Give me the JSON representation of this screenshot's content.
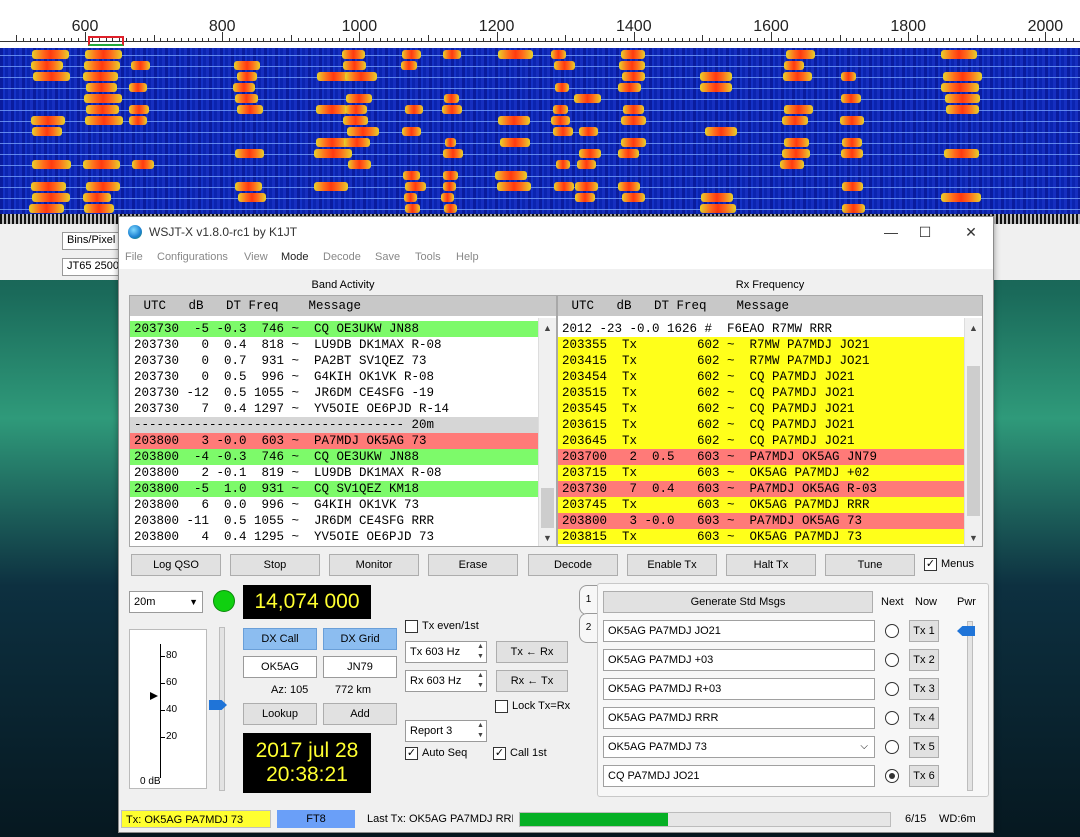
{
  "waterfall": {
    "freq_ticks": [
      "600",
      "800",
      "1000",
      "1200",
      "1400",
      "1600",
      "1800",
      "2000"
    ],
    "bins_per_pixel_label": "Bins/Pixel",
    "mode_field": "JT65  2500"
  },
  "window": {
    "title": "WSJT-X   v1.8.0-rc1   by K1JT",
    "minimize": "—",
    "maximize": "☐",
    "close": "✕"
  },
  "menu": [
    "File",
    "Configurations",
    "View",
    "Mode",
    "Decode",
    "Save",
    "Tools",
    "Help"
  ],
  "band_activity": {
    "title": "Band Activity",
    "header": " UTC   dB   DT Freq    Message",
    "rows": [
      {
        "text": "203730  -5 -0.3  746 ~  CQ OE3UKW JN88",
        "style": "green"
      },
      {
        "text": "203730   0  0.4  818 ~  LU9DB DK1MAX R-08",
        "style": ""
      },
      {
        "text": "203730   0  0.7  931 ~  PA2BT SV1QEZ 73",
        "style": ""
      },
      {
        "text": "203730   0  0.5  996 ~  G4KIH OK1VK R-08",
        "style": ""
      },
      {
        "text": "203730 -12  0.5 1055 ~  JR6DM CE4SFG -19",
        "style": ""
      },
      {
        "text": "203730   7  0.4 1297 ~  YV5OIE OE6PJD R-14",
        "style": ""
      },
      {
        "text": "------------------------------------ 20m",
        "style": "sep"
      },
      {
        "text": "203800   3 -0.0  603 ~  PA7MDJ OK5AG 73",
        "style": "red"
      },
      {
        "text": "203800  -4 -0.3  746 ~  CQ OE3UKW JN88",
        "style": "green"
      },
      {
        "text": "203800   2 -0.1  819 ~  LU9DB DK1MAX R-08",
        "style": ""
      },
      {
        "text": "203800  -5  1.0  931 ~  CQ SV1QEZ KM18",
        "style": "green"
      },
      {
        "text": "203800   6  0.0  996 ~  G4KIH OK1VK 73",
        "style": ""
      },
      {
        "text": "203800 -11  0.5 1055 ~  JR6DM CE4SFG RRR",
        "style": ""
      },
      {
        "text": "203800   4  0.4 1295 ~  YV5OIE OE6PJD 73",
        "style": ""
      }
    ]
  },
  "rx_frequency": {
    "title": "Rx Frequency",
    "header": " UTC   dB   DT Freq    Message",
    "rows": [
      {
        "text": "2012 -23 -0.0 1626 #  F6EAO R7MW RRR",
        "style": ""
      },
      {
        "text": "203355  Tx        602 ~  R7MW PA7MDJ JO21",
        "style": "yellow"
      },
      {
        "text": "203415  Tx        602 ~  R7MW PA7MDJ JO21",
        "style": "yellow"
      },
      {
        "text": "203454  Tx        602 ~  CQ PA7MDJ JO21",
        "style": "yellow"
      },
      {
        "text": "203515  Tx        602 ~  CQ PA7MDJ JO21",
        "style": "yellow"
      },
      {
        "text": "203545  Tx        602 ~  CQ PA7MDJ JO21",
        "style": "yellow"
      },
      {
        "text": "203615  Tx        602 ~  CQ PA7MDJ JO21",
        "style": "yellow"
      },
      {
        "text": "203645  Tx        602 ~  CQ PA7MDJ JO21",
        "style": "yellow"
      },
      {
        "text": "203700   2  0.5   603 ~  PA7MDJ OK5AG JN79",
        "style": "red"
      },
      {
        "text": "203715  Tx        603 ~  OK5AG PA7MDJ +02",
        "style": "yellow"
      },
      {
        "text": "203730   7  0.4   603 ~  PA7MDJ OK5AG R-03",
        "style": "red"
      },
      {
        "text": "203745  Tx        603 ~  OK5AG PA7MDJ RRR",
        "style": "yellow"
      },
      {
        "text": "203800   3 -0.0   603 ~  PA7MDJ OK5AG 73",
        "style": "red"
      },
      {
        "text": "203815  Tx        603 ~  OK5AG PA7MDJ 73",
        "style": "yellow"
      }
    ]
  },
  "buttons": {
    "log_qso": "Log QSO",
    "stop": "Stop",
    "monitor": "Monitor",
    "erase": "Erase",
    "decode": "Decode",
    "enable_tx": "Enable Tx",
    "halt_tx": "Halt Tx",
    "tune": "Tune",
    "menus": "Menus",
    "dx_call": "DX Call",
    "dx_grid": "DX Grid",
    "lookup": "Lookup",
    "add": "Add",
    "tx_from_rx": "Tx ← Rx",
    "rx_from_tx": "Rx ← Tx"
  },
  "controls": {
    "band": "20m",
    "frequency": "14,074 000",
    "dx_call_value": "OK5AG",
    "dx_grid_value": "JN79",
    "azimuth": "Az: 105",
    "distance": "772 km",
    "date": "2017 jul 28",
    "time": "20:38:21",
    "tx_even": "Tx even/1st",
    "tx_freq": "Tx  603  Hz",
    "rx_freq": "Rx  603  Hz",
    "lock_tx_rx": "Lock Tx=Rx",
    "report": "Report 3",
    "auto_seq": "Auto Seq",
    "call_1st": "Call 1st",
    "meter_labels": [
      "80",
      "60",
      "40",
      "20"
    ],
    "meter_unit": "0 dB",
    "meter_level_db": 60
  },
  "tx_messages": {
    "tab1": "1",
    "tab2": "2",
    "generate": "Generate Std Msgs",
    "next_label": "Next",
    "now_label": "Now",
    "pwr_label": "Pwr",
    "items": [
      {
        "text": "OK5AG PA7MDJ JO21",
        "button": "Tx 1"
      },
      {
        "text": "OK5AG PA7MDJ +03",
        "button": "Tx 2"
      },
      {
        "text": "OK5AG PA7MDJ R+03",
        "button": "Tx 3"
      },
      {
        "text": "OK5AG PA7MDJ RRR",
        "button": "Tx 4"
      },
      {
        "text": "OK5AG PA7MDJ 73",
        "button": "Tx 5"
      },
      {
        "text": "CQ PA7MDJ JO21",
        "button": "Tx 6"
      }
    ],
    "selected_index": 5
  },
  "status": {
    "tx_message": "Tx: OK5AG PA7MDJ 73",
    "mode": "FT8",
    "last_tx": "Last Tx: OK5AG PA7MDJ RRR",
    "progress_fraction": 0.4,
    "counter": "6/15",
    "watchdog": "WD:6m"
  },
  "colors": {
    "green_row": "#7dfa6a",
    "red_row": "#ff7a78",
    "yellow_row": "#ffff1a",
    "display_text": "#ffff30"
  }
}
